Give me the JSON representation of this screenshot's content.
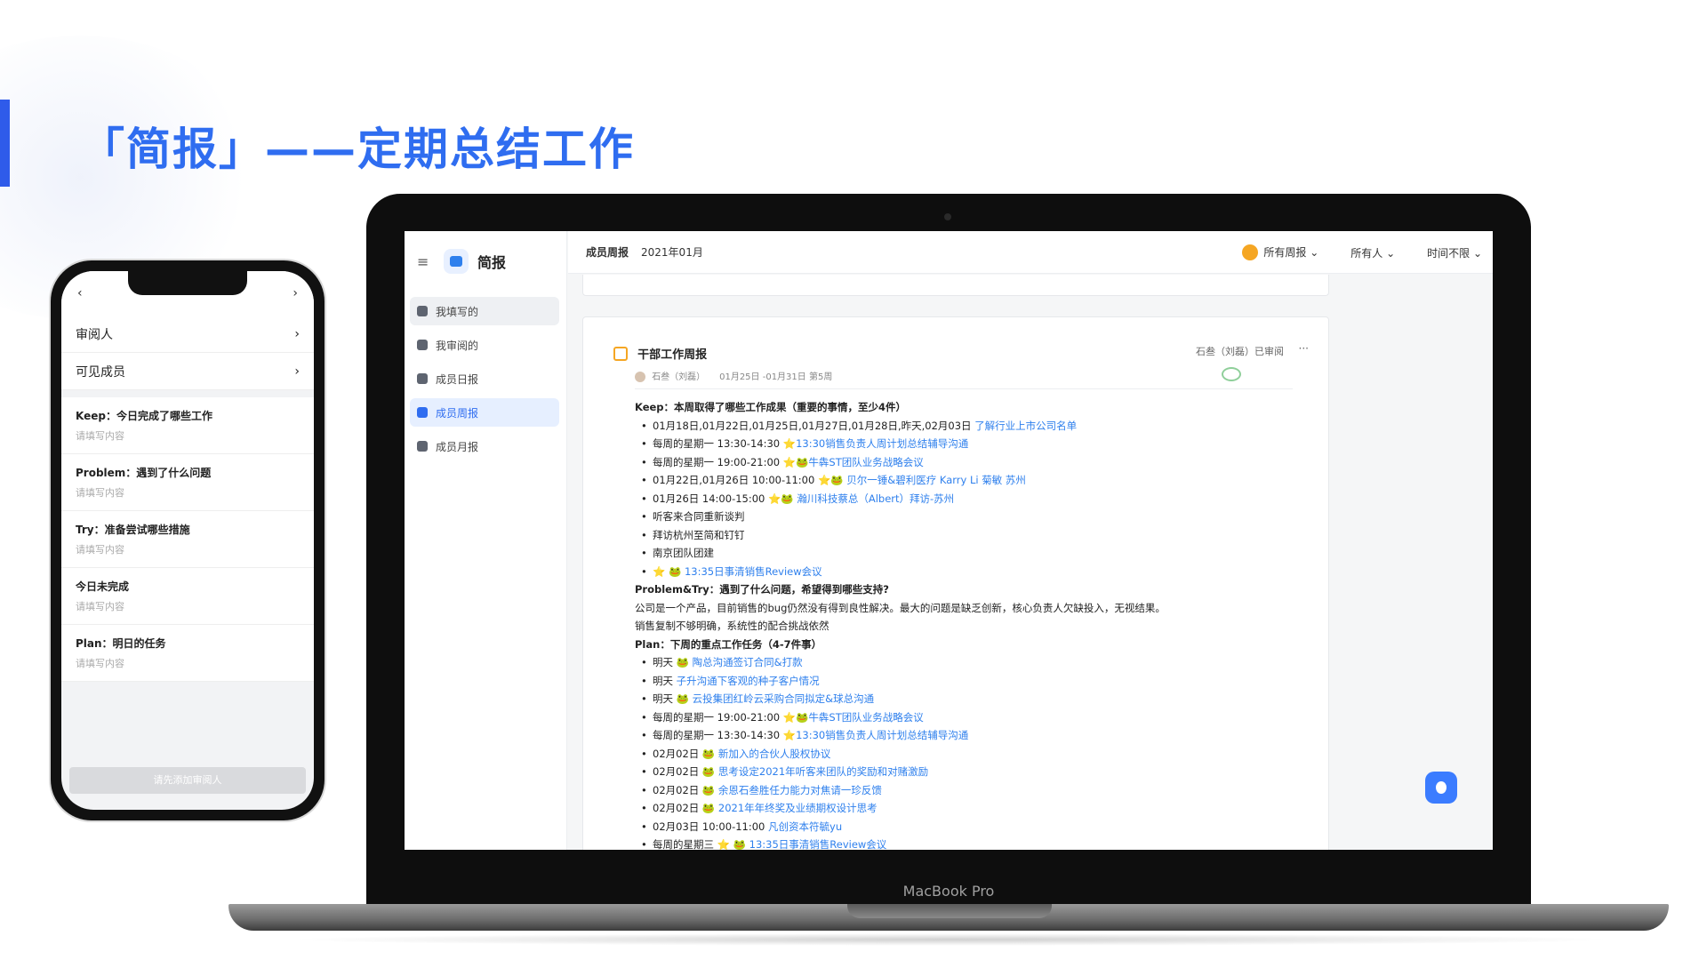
{
  "headline": "「简报」——定期总结工作",
  "phone": {
    "rows": [
      "审阅人",
      "可见成员"
    ],
    "chevron": "›",
    "back": "‹",
    "forward": "›",
    "items": [
      {
        "title": "Keep：今日完成了哪些工作",
        "placeholder": "请填写内容"
      },
      {
        "title": "Problem：遇到了什么问题",
        "placeholder": "请填写内容"
      },
      {
        "title": "Try：准备尝试哪些措施",
        "placeholder": "请填写内容"
      },
      {
        "title": "今日未完成",
        "placeholder": "请填写内容"
      },
      {
        "title": "Plan：明日的任务",
        "placeholder": "请填写内容"
      }
    ],
    "button": "请先添加审阅人"
  },
  "laptop": {
    "label": "MacBook Pro"
  },
  "app": {
    "brand": "简报",
    "nav": [
      "我填写的",
      "我审阅的",
      "成员日报",
      "成员周报",
      "成员月报"
    ],
    "topbar": {
      "title": "成员周报",
      "period": "2021年01月",
      "filter_reports": "所有周报 ⌄",
      "filter_people": "所有人 ⌄",
      "filter_time": "时间不限 ⌄"
    },
    "card": {
      "title": "干部工作周报",
      "author": "石叁（刘磊）",
      "range": "01月25日 -01月31日 第5周",
      "reviewed": "石叁（刘磊）已审阅",
      "more": "···",
      "keep_heading": "Keep：本周取得了哪些工作成果（重要的事情，至少4件）",
      "keep": [
        {
          "text": "01月18日,01月22日,01月25日,01月27日,01月28日,昨天,02月03日 ",
          "link": "了解行业上市公司名单",
          "star": "",
          "frog": ""
        },
        {
          "text": "每周的星期一 13:30-14:30 ",
          "star": "⭐",
          "link": "13:30销售负责人周计划总结辅导沟通",
          "frog": ""
        },
        {
          "text": "每周的星期一 19:00-21:00 ",
          "star": "⭐",
          "frog": "🐸",
          "link": "牛犇ST团队业务战略会议"
        },
        {
          "text": "01月22日,01月26日 10:00-11:00 ",
          "star": "⭐",
          "frog": "🐸",
          "link": " 贝尔一锤&碧利医疗 Karry Li 菊敏 苏州"
        },
        {
          "text": "01月26日 14:00-15:00 ",
          "star": "⭐",
          "frog": "🐸",
          "link": " 瀚川科技蔡总（Albert）拜访-苏州"
        },
        {
          "text": "听客来合同重新谈判",
          "star": "",
          "frog": "",
          "link": ""
        },
        {
          "text": "拜访杭州至简和钉钉",
          "star": "",
          "frog": "",
          "link": ""
        },
        {
          "text": "南京团队团建",
          "star": "",
          "frog": "",
          "link": ""
        },
        {
          "text": "",
          "star": "⭐",
          "frog": " 🐸",
          "link": " 13:35日事清销售Review会议"
        }
      ],
      "problem_heading": "Problem&Try：遇到了什么问题，希望得到哪些支持?",
      "problem_lines": [
        "公司是一个产品，目前销售的bug仍然没有得到良性解决。最大的问题是缺乏创新，核心负责人欠缺投入，无视结果。",
        "销售复制不够明确，系统性的配合挑战依然"
      ],
      "plan_heading": "Plan：下周的重点工作任务（4-7件事）",
      "plan": [
        {
          "text": "明天 ",
          "star": "",
          "frog": "🐸",
          "link": " 陶总沟通签订合同&打款"
        },
        {
          "text": "明天 ",
          "star": "",
          "frog": "",
          "link": "子升沟通下客观的种子客户情况"
        },
        {
          "text": "明天 ",
          "star": "",
          "frog": "🐸",
          "link": " 云投集团红岭云采购合同拟定&球总沟通"
        },
        {
          "text": "每周的星期一 19:00-21:00 ",
          "star": "⭐",
          "frog": "🐸",
          "link": "牛犇ST团队业务战略会议"
        },
        {
          "text": "每周的星期一 13:30-14:30 ",
          "star": "⭐",
          "frog": "",
          "link": "13:30销售负责人周计划总结辅导沟通"
        },
        {
          "text": "02月02日 ",
          "star": "",
          "frog": "🐸",
          "link": " 新加入的合伙人股权协议"
        },
        {
          "text": "02月02日 ",
          "star": "",
          "frog": "🐸",
          "link": " 思考设定2021年听客来团队的奖励和对赌激励"
        },
        {
          "text": "02月02日 ",
          "star": "",
          "frog": "🐸",
          "link": " 余恩石叁胜任力能力对焦请一珍反馈"
        },
        {
          "text": "02月02日 ",
          "star": "",
          "frog": "🐸",
          "link": " 2021年年终奖及业绩期权设计思考"
        },
        {
          "text": "02月03日 10:00-11:00 ",
          "star": "",
          "frog": "",
          "link": "凡创资本符毓yu"
        },
        {
          "text": "每周的星期三 ",
          "star": "⭐",
          "frog": " 🐸",
          "link": " 13:35日事清销售Review会议"
        }
      ]
    }
  },
  "colors": {
    "accent": "#2f6df0",
    "link": "#2f80ed",
    "frog": "#2f9e44",
    "star": "#f5b400"
  },
  "icons": [
    "menu-icon",
    "logo-icon",
    "calendar-icon",
    "lightbulb-icon",
    "chevron-right-icon"
  ]
}
